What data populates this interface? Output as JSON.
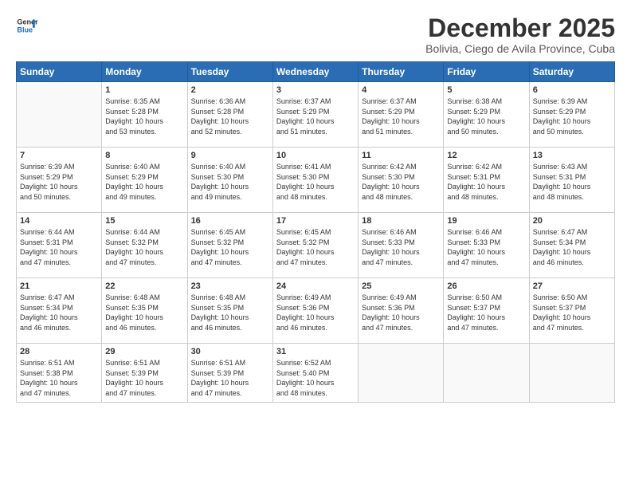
{
  "logo": {
    "line1": "General",
    "line2": "Blue"
  },
  "title": "December 2025",
  "subtitle": "Bolivia, Ciego de Avila Province, Cuba",
  "headers": [
    "Sunday",
    "Monday",
    "Tuesday",
    "Wednesday",
    "Thursday",
    "Friday",
    "Saturday"
  ],
  "weeks": [
    [
      {
        "day": "",
        "info": ""
      },
      {
        "day": "1",
        "info": "Sunrise: 6:35 AM\nSunset: 5:28 PM\nDaylight: 10 hours\nand 53 minutes."
      },
      {
        "day": "2",
        "info": "Sunrise: 6:36 AM\nSunset: 5:28 PM\nDaylight: 10 hours\nand 52 minutes."
      },
      {
        "day": "3",
        "info": "Sunrise: 6:37 AM\nSunset: 5:29 PM\nDaylight: 10 hours\nand 51 minutes."
      },
      {
        "day": "4",
        "info": "Sunrise: 6:37 AM\nSunset: 5:29 PM\nDaylight: 10 hours\nand 51 minutes."
      },
      {
        "day": "5",
        "info": "Sunrise: 6:38 AM\nSunset: 5:29 PM\nDaylight: 10 hours\nand 50 minutes."
      },
      {
        "day": "6",
        "info": "Sunrise: 6:39 AM\nSunset: 5:29 PM\nDaylight: 10 hours\nand 50 minutes."
      }
    ],
    [
      {
        "day": "7",
        "info": "Sunrise: 6:39 AM\nSunset: 5:29 PM\nDaylight: 10 hours\nand 50 minutes."
      },
      {
        "day": "8",
        "info": "Sunrise: 6:40 AM\nSunset: 5:29 PM\nDaylight: 10 hours\nand 49 minutes."
      },
      {
        "day": "9",
        "info": "Sunrise: 6:40 AM\nSunset: 5:30 PM\nDaylight: 10 hours\nand 49 minutes."
      },
      {
        "day": "10",
        "info": "Sunrise: 6:41 AM\nSunset: 5:30 PM\nDaylight: 10 hours\nand 48 minutes."
      },
      {
        "day": "11",
        "info": "Sunrise: 6:42 AM\nSunset: 5:30 PM\nDaylight: 10 hours\nand 48 minutes."
      },
      {
        "day": "12",
        "info": "Sunrise: 6:42 AM\nSunset: 5:31 PM\nDaylight: 10 hours\nand 48 minutes."
      },
      {
        "day": "13",
        "info": "Sunrise: 6:43 AM\nSunset: 5:31 PM\nDaylight: 10 hours\nand 48 minutes."
      }
    ],
    [
      {
        "day": "14",
        "info": "Sunrise: 6:44 AM\nSunset: 5:31 PM\nDaylight: 10 hours\nand 47 minutes."
      },
      {
        "day": "15",
        "info": "Sunrise: 6:44 AM\nSunset: 5:32 PM\nDaylight: 10 hours\nand 47 minutes."
      },
      {
        "day": "16",
        "info": "Sunrise: 6:45 AM\nSunset: 5:32 PM\nDaylight: 10 hours\nand 47 minutes."
      },
      {
        "day": "17",
        "info": "Sunrise: 6:45 AM\nSunset: 5:32 PM\nDaylight: 10 hours\nand 47 minutes."
      },
      {
        "day": "18",
        "info": "Sunrise: 6:46 AM\nSunset: 5:33 PM\nDaylight: 10 hours\nand 47 minutes."
      },
      {
        "day": "19",
        "info": "Sunrise: 6:46 AM\nSunset: 5:33 PM\nDaylight: 10 hours\nand 47 minutes."
      },
      {
        "day": "20",
        "info": "Sunrise: 6:47 AM\nSunset: 5:34 PM\nDaylight: 10 hours\nand 46 minutes."
      }
    ],
    [
      {
        "day": "21",
        "info": "Sunrise: 6:47 AM\nSunset: 5:34 PM\nDaylight: 10 hours\nand 46 minutes."
      },
      {
        "day": "22",
        "info": "Sunrise: 6:48 AM\nSunset: 5:35 PM\nDaylight: 10 hours\nand 46 minutes."
      },
      {
        "day": "23",
        "info": "Sunrise: 6:48 AM\nSunset: 5:35 PM\nDaylight: 10 hours\nand 46 minutes."
      },
      {
        "day": "24",
        "info": "Sunrise: 6:49 AM\nSunset: 5:36 PM\nDaylight: 10 hours\nand 46 minutes."
      },
      {
        "day": "25",
        "info": "Sunrise: 6:49 AM\nSunset: 5:36 PM\nDaylight: 10 hours\nand 47 minutes."
      },
      {
        "day": "26",
        "info": "Sunrise: 6:50 AM\nSunset: 5:37 PM\nDaylight: 10 hours\nand 47 minutes."
      },
      {
        "day": "27",
        "info": "Sunrise: 6:50 AM\nSunset: 5:37 PM\nDaylight: 10 hours\nand 47 minutes."
      }
    ],
    [
      {
        "day": "28",
        "info": "Sunrise: 6:51 AM\nSunset: 5:38 PM\nDaylight: 10 hours\nand 47 minutes."
      },
      {
        "day": "29",
        "info": "Sunrise: 6:51 AM\nSunset: 5:39 PM\nDaylight: 10 hours\nand 47 minutes."
      },
      {
        "day": "30",
        "info": "Sunrise: 6:51 AM\nSunset: 5:39 PM\nDaylight: 10 hours\nand 47 minutes."
      },
      {
        "day": "31",
        "info": "Sunrise: 6:52 AM\nSunset: 5:40 PM\nDaylight: 10 hours\nand 48 minutes."
      },
      {
        "day": "",
        "info": ""
      },
      {
        "day": "",
        "info": ""
      },
      {
        "day": "",
        "info": ""
      }
    ]
  ]
}
